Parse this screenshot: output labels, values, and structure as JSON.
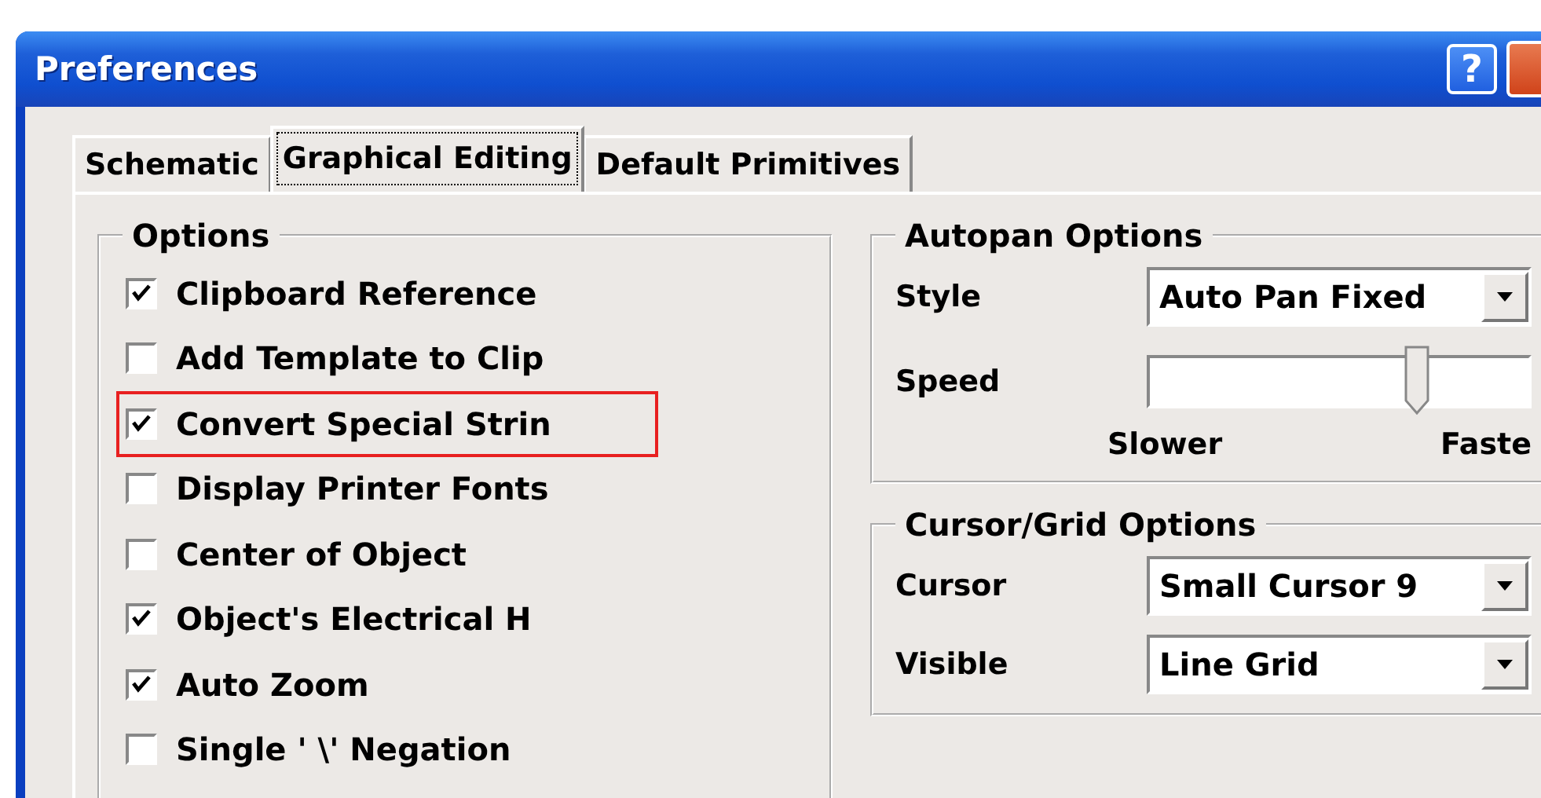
{
  "window": {
    "title": "Preferences",
    "help_button": "?"
  },
  "tabs": [
    {
      "label": "Schematic",
      "selected": false
    },
    {
      "label": "Graphical Editing",
      "selected": true
    },
    {
      "label": "Default Primitives",
      "selected": false
    }
  ],
  "options": {
    "title": "Options",
    "items": [
      {
        "label": "Clipboard Reference",
        "checked": true,
        "highlighted": false
      },
      {
        "label": "Add Template to Clip",
        "checked": false,
        "highlighted": false
      },
      {
        "label": "Convert Special Strin",
        "checked": true,
        "highlighted": true
      },
      {
        "label": "Display Printer Fonts",
        "checked": false,
        "highlighted": false
      },
      {
        "label": "Center of Object",
        "checked": false,
        "highlighted": false
      },
      {
        "label": "Object's Electrical H",
        "checked": true,
        "highlighted": false
      },
      {
        "label": "Auto Zoom",
        "checked": true,
        "highlighted": false
      },
      {
        "label": "Single ' \\' Negation",
        "checked": false,
        "highlighted": false
      }
    ]
  },
  "autopan": {
    "title": "Autopan Options",
    "style_label": "Style",
    "style_value": "Auto Pan Fixed",
    "speed_label": "Speed",
    "speed": {
      "level": 0.7
    },
    "slower": "Slower",
    "faster": "Faste"
  },
  "cursor_grid": {
    "title": "Cursor/Grid Options",
    "cursor_label": "Cursor",
    "cursor_value": "Small Cursor 9",
    "visible_label": "Visible",
    "visible_value": "Line Grid"
  }
}
